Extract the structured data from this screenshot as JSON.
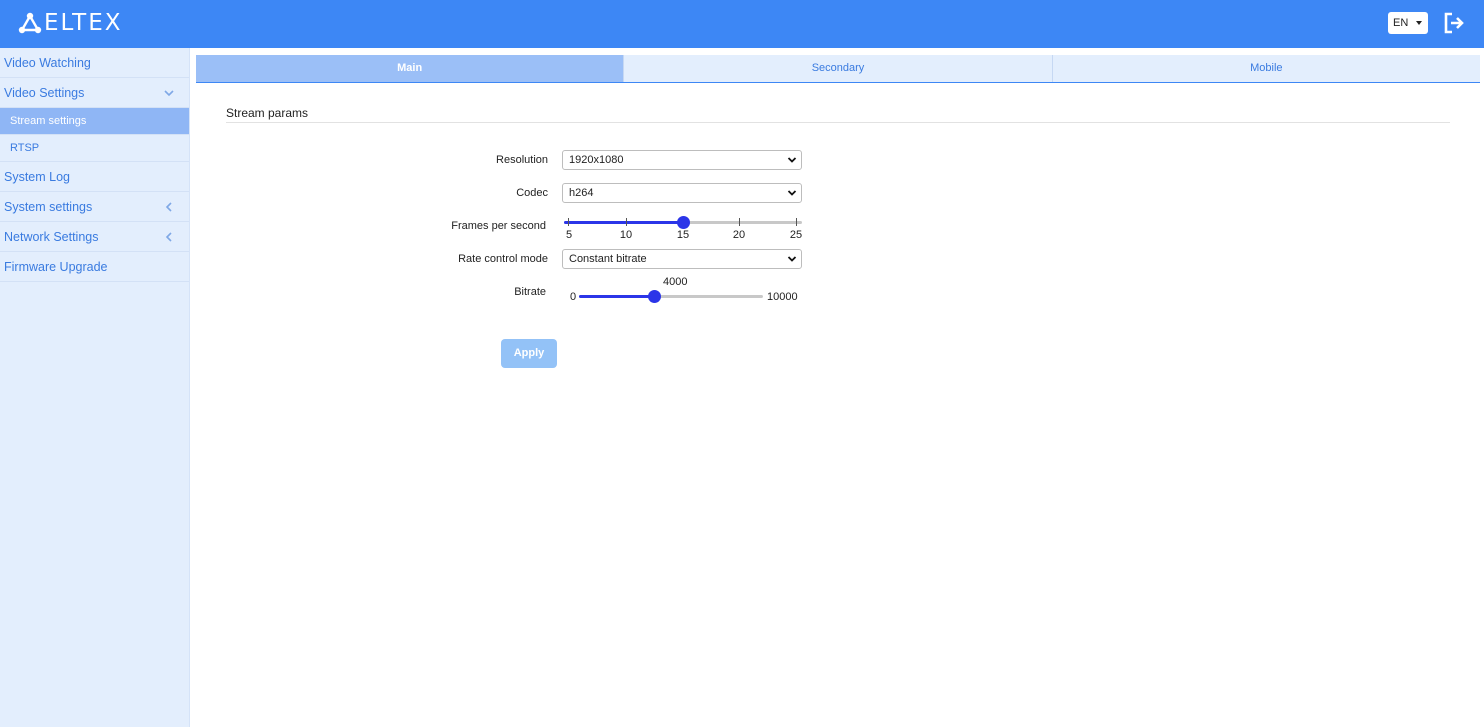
{
  "header": {
    "logo_text": "ELTEX",
    "language": "EN"
  },
  "sidebar": {
    "items": [
      {
        "label": "Video Watching"
      },
      {
        "label": "Video Settings"
      },
      {
        "label": "Stream settings"
      },
      {
        "label": "RTSP"
      },
      {
        "label": "System Log"
      },
      {
        "label": "System settings"
      },
      {
        "label": "Network Settings"
      },
      {
        "label": "Firmware Upgrade"
      }
    ]
  },
  "tabs": [
    {
      "label": "Main"
    },
    {
      "label": "Secondary"
    },
    {
      "label": "Mobile"
    }
  ],
  "section": {
    "title": "Stream params"
  },
  "form": {
    "resolution": {
      "label": "Resolution",
      "value": "1920x1080"
    },
    "codec": {
      "label": "Codec",
      "value": "h264"
    },
    "fps": {
      "label": "Frames per second",
      "ticks": [
        "5",
        "10",
        "15",
        "20",
        "25"
      ],
      "value": 15
    },
    "rate_control": {
      "label": "Rate control mode",
      "value": "Constant bitrate"
    },
    "bitrate": {
      "label": "Bitrate",
      "min": "0",
      "max": "10000",
      "value": "4000"
    },
    "apply_label": "Apply"
  },
  "colors": {
    "header": "#3d87f5",
    "accent": "#2b35e8",
    "sidebar_bg": "#e3eefd",
    "active_item": "#8fb6f5"
  }
}
